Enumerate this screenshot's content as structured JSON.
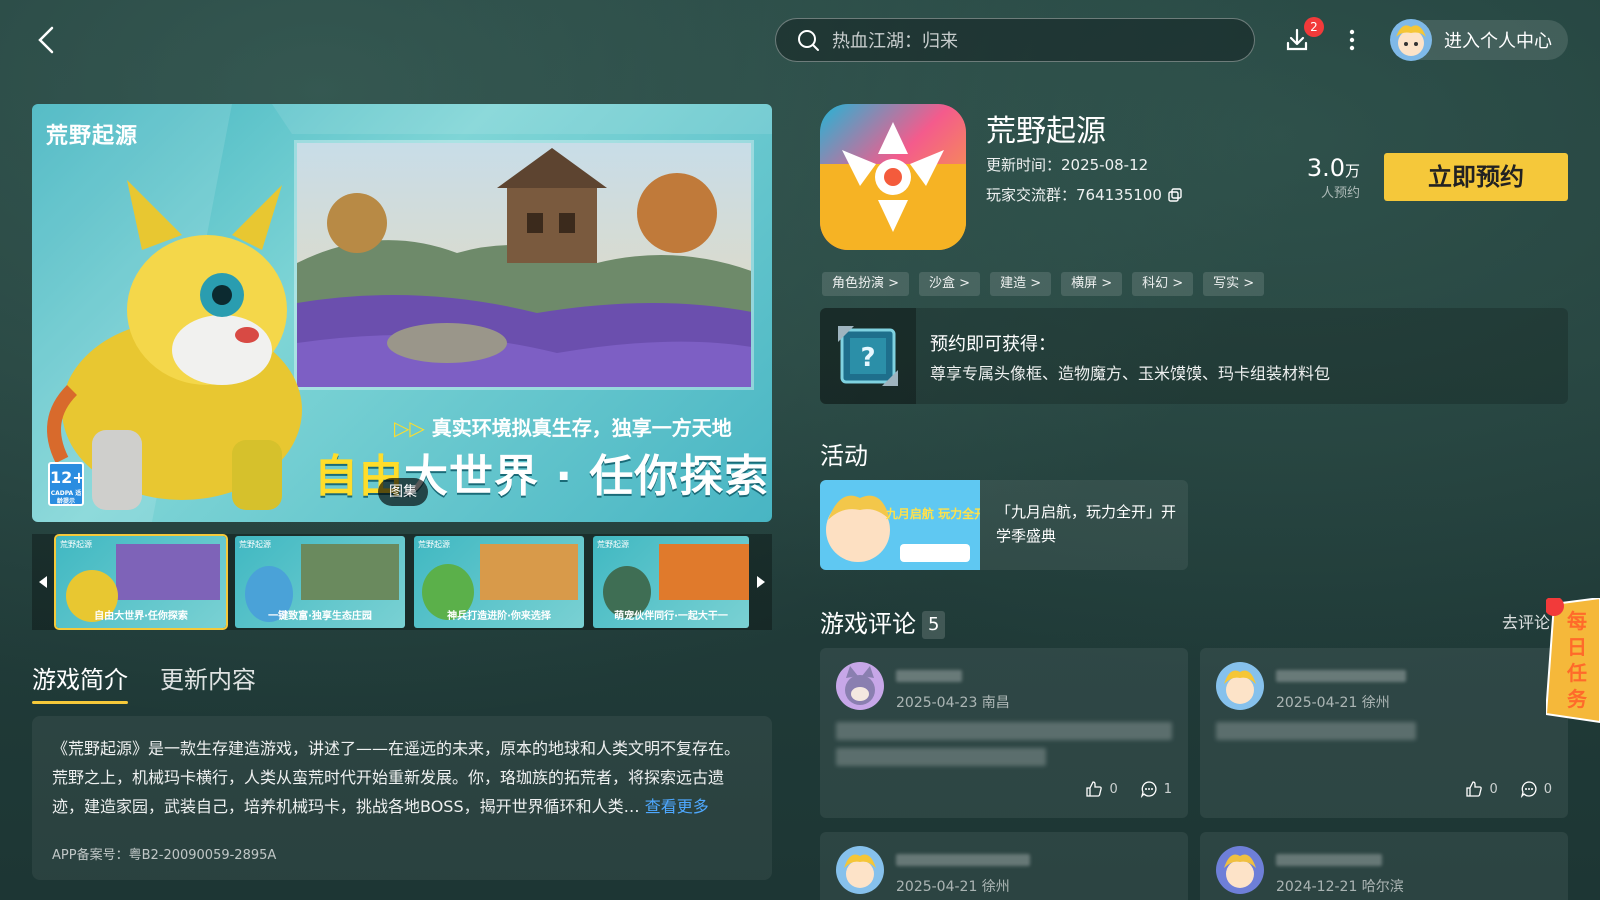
{
  "header": {
    "search_placeholder": "热血江湖：归来",
    "download_badge": "2",
    "user_center_label": "进入个人中心"
  },
  "hero": {
    "logo_text": "荒野起源",
    "tagline": "真实环境拟真生存，独享一方天地",
    "headline_yellow": "自由",
    "headline_rest": "大世界 · 任你探索",
    "age_rating": "12+",
    "age_sub": "CADPA 适龄提示",
    "gallery_label": "图集"
  },
  "thumbnails": [
    {
      "logo": "荒野起源",
      "caption": "自由大世界·任你探索"
    },
    {
      "logo": "荒野起源",
      "caption": "一键致富·独享生态庄园"
    },
    {
      "logo": "荒野起源",
      "caption": "神兵打造进阶·你来选择"
    },
    {
      "logo": "荒野起源",
      "caption": "萌宠伙伴同行·一起大干一"
    }
  ],
  "tabs": [
    "游戏简介",
    "更新内容"
  ],
  "intro": {
    "text": "《荒野起源》是一款生存建造游戏，讲述了——在遥远的未来，原本的地球和人类文明不复存在。荒野之上，机械玛卡横行，人类从蛮荒时代开始重新发展。你，珞珈族的拓荒者，将探索远古遗迹，建造家园，武装自己，培养机械玛卡，挑战各地BOSS，揭开世界循环和人类…",
    "see_more": "查看更多",
    "icp": "APP备案号：粤B2-20090059-2895A"
  },
  "game": {
    "title": "荒野起源",
    "update_time": "更新时间：2025-08-12",
    "player_group": "玩家交流群：764135100",
    "reserve_number": "3.0",
    "reserve_unit": "万",
    "reserve_label": "人预约",
    "reserve_button": "立即预约"
  },
  "tags": [
    "角色扮演 >",
    "沙盒 >",
    "建造 >",
    "横屏 >",
    "科幻 >",
    "写实 >"
  ],
  "reward": {
    "title": "预约即可获得：",
    "desc": "尊享专属头像框、造物魔方、玉米馍馍、玛卡组装材料包"
  },
  "activity": {
    "section_title": "活动",
    "item_text": "「九月启航，玩力全开」开学季盛典",
    "thumb_text": "九月启航 玩力全开"
  },
  "reviews": {
    "section_title": "游戏评论",
    "count": "5",
    "go_review": "去评论",
    "items": [
      {
        "meta": "2025-04-23 南昌",
        "likes": "0",
        "comments": "1"
      },
      {
        "meta": "2025-04-21 徐州",
        "likes": "0",
        "comments": "0"
      },
      {
        "meta": "2025-04-21 徐州"
      },
      {
        "meta": "2024-12-21 哈尔滨"
      }
    ]
  },
  "daily_task": {
    "label": "每日任务"
  },
  "colors": {
    "accent": "#f5c83a",
    "link": "#4ea8ff",
    "badge": "#f23a3a"
  }
}
